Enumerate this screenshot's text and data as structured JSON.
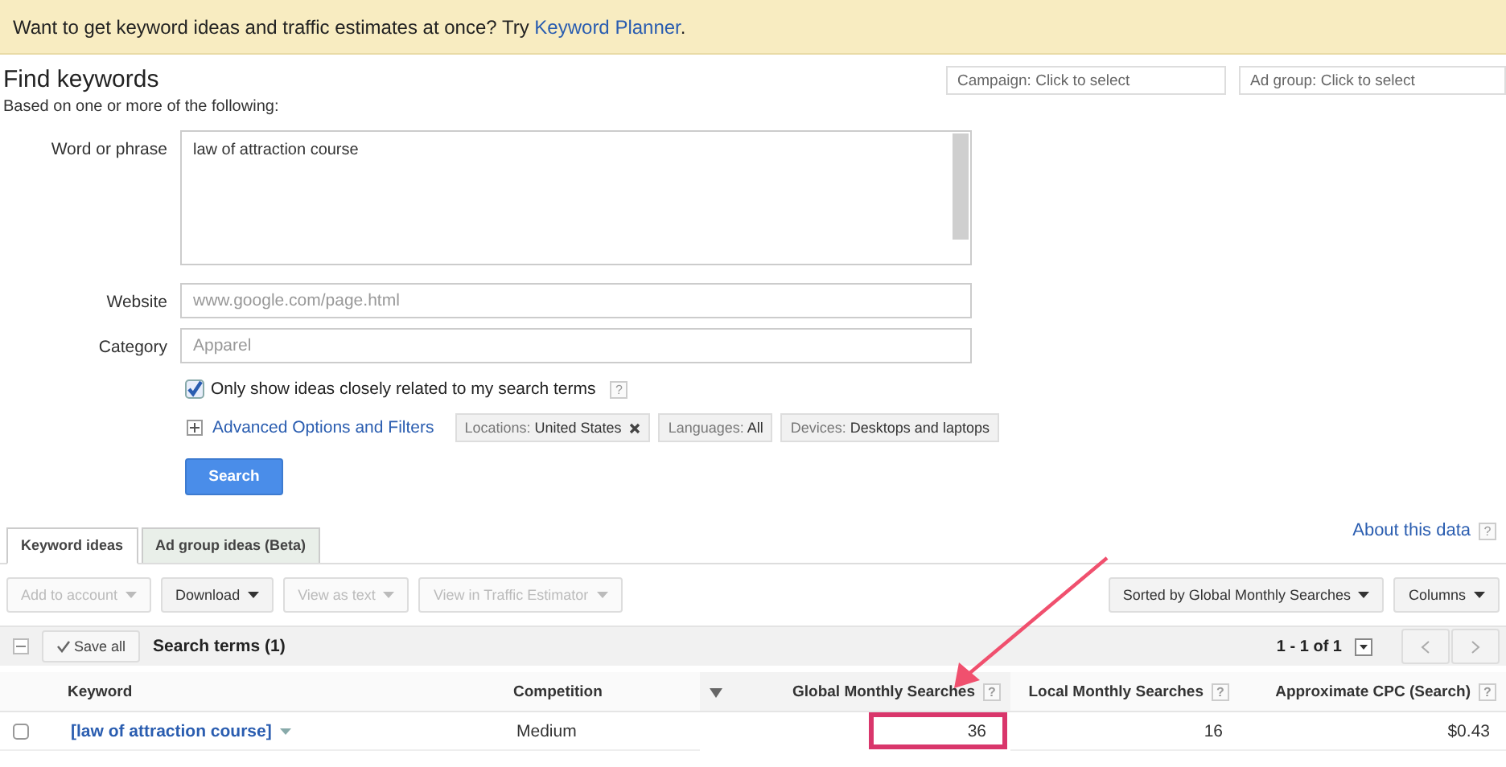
{
  "banner": {
    "text": "Want to get keyword ideas and traffic estimates at once? Try",
    "link": "Keyword Planner",
    "after": "."
  },
  "title": "Find keywords",
  "subtitle": "Based on one or more of the following:",
  "selectors": [
    {
      "label": "Campaign: Click to select"
    },
    {
      "label": "Ad group: Click to select"
    }
  ],
  "fields": [
    {
      "kind": "textarea",
      "label": "Word or phrase",
      "value": "law of attraction course"
    },
    {
      "kind": "input",
      "label": "Website",
      "placeholder": "www.google.com/page.html"
    },
    {
      "kind": "input",
      "label": "Category",
      "placeholder": "Apparel"
    }
  ],
  "only_related": {
    "label": "Only show ideas closely related to my search terms",
    "checked": true,
    "help": "?"
  },
  "advanced": {
    "label": "Advanced Options and Filters",
    "expanded": false
  },
  "filters": [
    {
      "name": "Locations:",
      "value": "United States",
      "removable": true
    },
    {
      "name": "Languages:",
      "value": "All",
      "removable": false
    },
    {
      "name": "Devices:",
      "value": "Desktops and laptops",
      "removable": false
    }
  ],
  "search_button": "Search",
  "tabs": [
    {
      "label": "Keyword ideas",
      "selected": true
    },
    {
      "label": "Ad group ideas (Beta)",
      "selected": false
    }
  ],
  "about": {
    "label": "About this data",
    "help": "?"
  },
  "toolbar": [
    {
      "label": "Add to account",
      "disabled": true
    },
    {
      "label": "Download",
      "disabled": false
    },
    {
      "label": "View as text",
      "disabled": true
    },
    {
      "label": "View in Traffic Estimator",
      "disabled": true
    }
  ],
  "sort_button": "Sorted by Global Monthly Searches",
  "columns_button": "Columns",
  "group": {
    "save_all": "Save all",
    "title": "Search terms (1)",
    "pagination": "1 - 1 of 1"
  },
  "table": {
    "columns": [
      {
        "label": "Keyword",
        "sorted": false
      },
      {
        "label": "Competition",
        "sorted": false
      },
      {
        "label": "Global Monthly Searches",
        "help": "?",
        "sorted": true
      },
      {
        "label": "Local Monthly Searches",
        "help": "?",
        "sorted": false
      },
      {
        "label": "Approximate CPC (Search)",
        "help": "?",
        "sorted": false
      }
    ],
    "rows": [
      {
        "checked": false,
        "cells": [
          {
            "text": "[law of attraction course]",
            "highlighted": false
          },
          {
            "text": "Medium",
            "highlighted": false
          },
          {
            "text": "36",
            "highlighted": true
          },
          {
            "text": "16",
            "highlighted": false
          },
          {
            "text": "$0.43",
            "highlighted": false
          }
        ]
      }
    ]
  }
}
